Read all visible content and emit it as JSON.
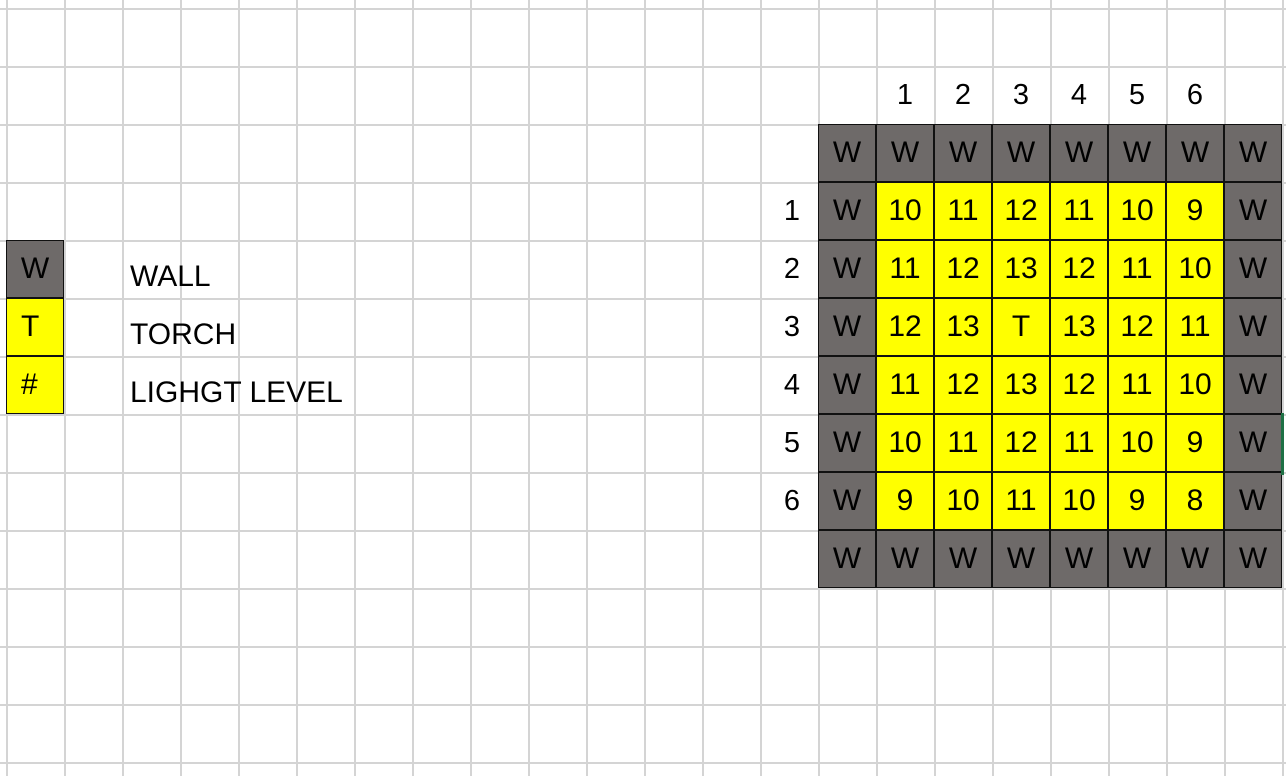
{
  "legend": [
    {
      "symbol": "W",
      "label": "WALL",
      "kind": "wall"
    },
    {
      "symbol": "T",
      "label": "TORCH",
      "kind": "lit"
    },
    {
      "symbol": "#",
      "label": "LIGHGT LEVEL",
      "kind": "lit"
    }
  ],
  "grid": {
    "column_headers": [
      "1",
      "2",
      "3",
      "4",
      "5",
      "6"
    ],
    "row_headers": [
      "1",
      "2",
      "3",
      "4",
      "5",
      "6"
    ],
    "wall_symbol": "W",
    "rows": [
      [
        "10",
        "11",
        "12",
        "11",
        "10",
        "9"
      ],
      [
        "11",
        "12",
        "13",
        "12",
        "11",
        "10"
      ],
      [
        "12",
        "13",
        "T",
        "13",
        "12",
        "11"
      ],
      [
        "11",
        "12",
        "13",
        "12",
        "11",
        "10"
      ],
      [
        "10",
        "11",
        "12",
        "11",
        "10",
        "9"
      ],
      [
        "9",
        "10",
        "11",
        "10",
        "9",
        "8"
      ]
    ]
  },
  "colors": {
    "wall": "#6e6a69",
    "lit": "#ffff00",
    "gridline": "#d4d4d4"
  }
}
